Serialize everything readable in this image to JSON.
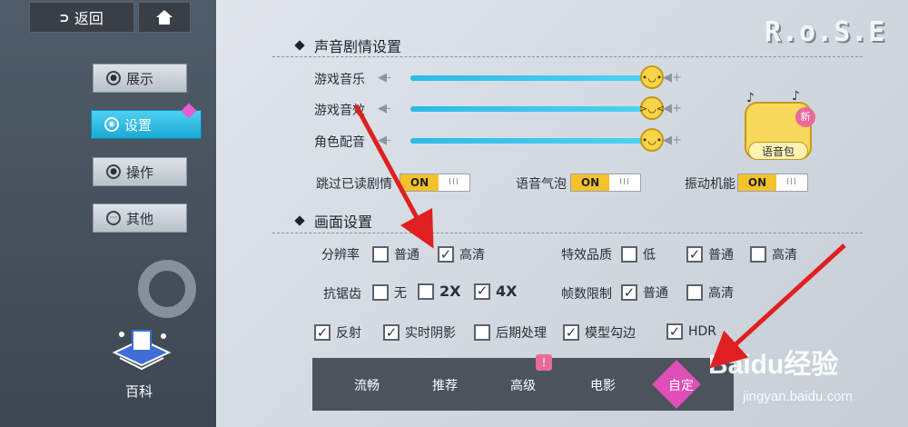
{
  "nav": {
    "back_label": "返回",
    "items": [
      {
        "label": "展示"
      },
      {
        "label": "设置"
      },
      {
        "label": "操作"
      },
      {
        "label": "其他"
      }
    ],
    "wiki_label": "百科"
  },
  "logo": "R.o.S.E",
  "audio": {
    "title": "声音剧情设置",
    "sliders": [
      {
        "label": "游戏音乐",
        "value_fraction": 1.0
      },
      {
        "label": "游戏音效",
        "value_fraction": 1.0
      },
      {
        "label": "角色配音",
        "value_fraction": 1.0
      }
    ],
    "voice_pack_label": "语音包",
    "new_badge": "新",
    "toggles": [
      {
        "label": "跳过已读剧情",
        "on_text": "ON",
        "off_text": "III"
      },
      {
        "label": "语音气泡",
        "on_text": "ON",
        "off_text": "III"
      },
      {
        "label": "振动机能",
        "on_text": "ON",
        "off_text": "III"
      }
    ]
  },
  "graphics": {
    "title": "画面设置",
    "resolution": {
      "label": "分辨率",
      "options": [
        {
          "label": "普通",
          "checked": false
        },
        {
          "label": "高清",
          "checked": true
        }
      ]
    },
    "effects_quality": {
      "label": "特效品质",
      "options": [
        {
          "label": "低",
          "checked": false
        },
        {
          "label": "普通",
          "checked": true
        },
        {
          "label": "高清",
          "checked": false
        }
      ]
    },
    "antialias": {
      "label": "抗锯齿",
      "options": [
        {
          "label": "无",
          "checked": false
        },
        {
          "label": "2X",
          "checked": false
        },
        {
          "label": "4X",
          "checked": true
        }
      ]
    },
    "frame_limit": {
      "label": "帧数限制",
      "options": [
        {
          "label": "普通",
          "checked": true
        },
        {
          "label": "高清",
          "checked": false
        }
      ]
    },
    "extras": [
      {
        "label": "反射",
        "checked": true
      },
      {
        "label": "实时阴影",
        "checked": true
      },
      {
        "label": "后期处理",
        "checked": false
      },
      {
        "label": "模型勾边",
        "checked": true
      },
      {
        "label": "HDR",
        "checked": true
      }
    ]
  },
  "presets": {
    "items": [
      "流畅",
      "推荐",
      "高级",
      "电影",
      "自定"
    ],
    "selected": "自定",
    "alert_icon": "!"
  },
  "watermark": {
    "brand": "Baidu经验",
    "url": "jingyan.baidu.com"
  },
  "colors": {
    "accent": "#1aa9d6",
    "toggle_on": "#f5c22b",
    "preset_selected": "#e04fb8",
    "annotation": "#e02020"
  }
}
